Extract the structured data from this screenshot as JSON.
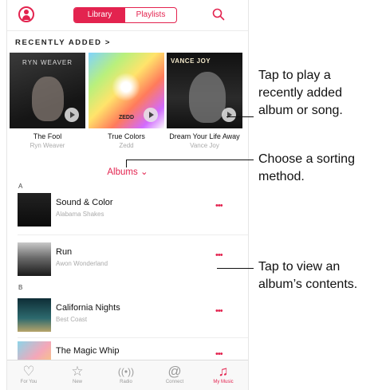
{
  "header": {
    "segments": [
      "Library",
      "Playlists"
    ],
    "active_segment": "Library",
    "profile_icon": "profile-icon",
    "search_icon": "search-icon"
  },
  "recently_added": {
    "title": "RECENTLY ADDED",
    "chevron": ">",
    "albums": [
      {
        "title": "The Fool",
        "artist": "Ryn Weaver",
        "cover_text": "RYN WEAVER"
      },
      {
        "title": "True Colors",
        "artist": "Zedd",
        "cover_text": "ZEDD"
      },
      {
        "title": "Dream Your Life Away",
        "artist": "Vance Joy",
        "cover_text": "VANCE JOY"
      }
    ]
  },
  "sort": {
    "label": "Albums",
    "chevron": "⌄"
  },
  "sections": [
    {
      "letter": "A",
      "rows": [
        {
          "title": "Sound & Color",
          "artist": "Alabama Shakes",
          "more": "•••"
        },
        {
          "title": "Run",
          "artist": "Awon Wonderland",
          "more": "•••"
        }
      ]
    },
    {
      "letter": "B",
      "rows": [
        {
          "title": "California Nights",
          "artist": "Best Coast",
          "more": "•••"
        },
        {
          "title": "The Magic Whip",
          "artist": "",
          "more": "•••"
        }
      ]
    }
  ],
  "tabbar": [
    {
      "label": "For You",
      "icon": "heart-icon"
    },
    {
      "label": "New",
      "icon": "star-icon"
    },
    {
      "label": "Radio",
      "icon": "radio-icon"
    },
    {
      "label": "Connect",
      "icon": "at-icon"
    },
    {
      "label": "My Music",
      "icon": "music-note-icon"
    }
  ],
  "callouts": [
    "Tap to play a recently added album or song.",
    "Choose a sorting method.",
    "Tap to view an album’s contents."
  ],
  "colors": {
    "accent": "#e3234f"
  }
}
